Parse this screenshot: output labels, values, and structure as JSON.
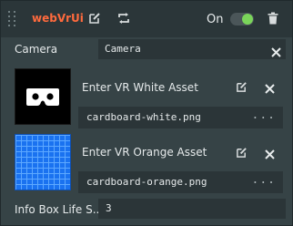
{
  "header": {
    "title": "webVrUi",
    "enabled_label": "On",
    "enabled": true,
    "icons": [
      "edit-icon",
      "swap-icon",
      "trash-icon"
    ]
  },
  "camera": {
    "label": "Camera",
    "value": "Camera"
  },
  "assets": [
    {
      "label": "Enter VR White Asset",
      "filename": "cardboard-white.png",
      "more": "...",
      "thumbnail_icon": "vr-headset-white-icon"
    },
    {
      "label": "Enter VR Orange Asset",
      "filename": "cardboard-orange.png",
      "more": "...",
      "thumbnail_icon": "blue-grid-texture"
    }
  ],
  "info_box": {
    "label": "Info Box Life S...",
    "value": "3"
  },
  "colors": {
    "title": "#ff6a3d",
    "toggle_on": "#7ad55a",
    "panel_bg": "#364346",
    "field_bg": "#2b3538"
  }
}
